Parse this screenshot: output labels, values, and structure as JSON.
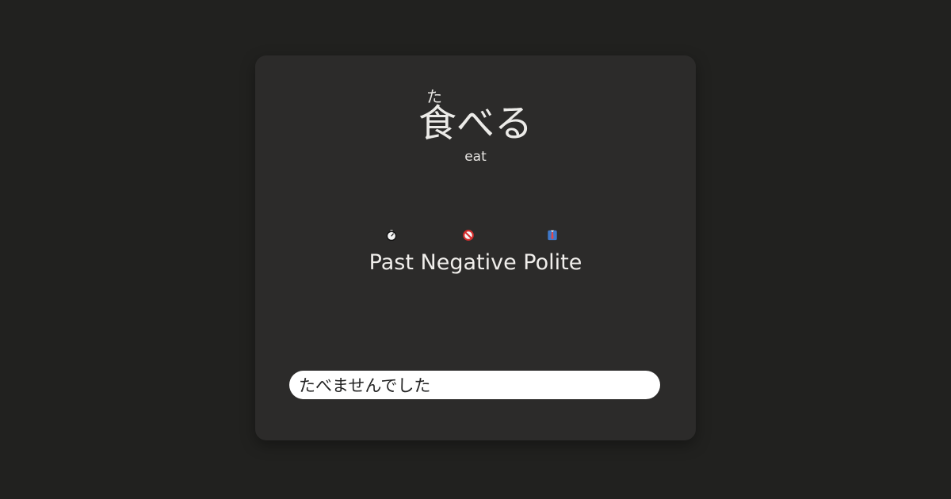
{
  "card": {
    "furigana": "た",
    "word": "食べる",
    "meaning": "eat",
    "form": [
      {
        "label": "Past",
        "icon": "stopwatch-icon"
      },
      {
        "label": "Negative",
        "icon": "prohibited-icon"
      },
      {
        "label": "Polite",
        "icon": "necktie-icon"
      }
    ],
    "answer_value": "たべませんでした"
  },
  "colors": {
    "background": "#21211f",
    "card": "#2c2b2a",
    "text": "#ecebe8",
    "input": "#ffffff"
  }
}
